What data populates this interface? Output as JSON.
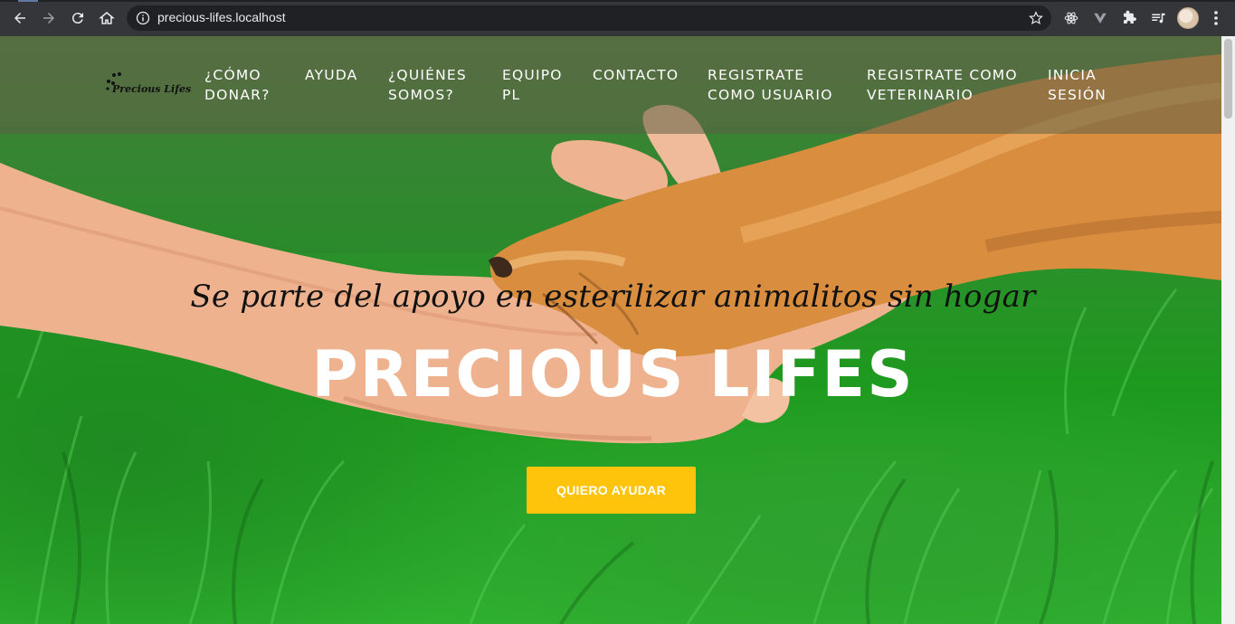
{
  "browser": {
    "url": "precious-lifes.localhost",
    "icons": [
      "back-icon",
      "forward-icon",
      "reload-icon",
      "home-icon",
      "info-icon",
      "star-icon",
      "react-devtools-icon",
      "vue-devtools-icon",
      "extensions-icon",
      "media-controls-icon",
      "profile-avatar",
      "more-menu-icon"
    ]
  },
  "site": {
    "logo_text": "Precious Lifes",
    "menu": [
      {
        "label_line1": "¿CÓMO",
        "label_line2": "DONAR?"
      },
      {
        "label_line1": "AYUDA",
        "label_line2": ""
      },
      {
        "label_line1": "¿QUIÉNES",
        "label_line2": "SOMOS?"
      },
      {
        "label_line1": "EQUIPO",
        "label_line2": "PL"
      },
      {
        "label_line1": "CONTACTO",
        "label_line2": ""
      },
      {
        "label_line1": "REGISTRATE",
        "label_line2": "COMO USUARIO"
      },
      {
        "label_line1": "REGISTRATE COMO",
        "label_line2": "VETERINARIO"
      },
      {
        "label_line1": "INICIA",
        "label_line2": "SESIÓN"
      }
    ],
    "hero": {
      "tagline": "Se parte del apoyo en esterilizar animalitos sin hogar",
      "title": "PRECIOUS LIFES",
      "cta_label": "QUIERO AYUDAR"
    },
    "colors": {
      "cta": "#fec40b",
      "menu_text": "#ffffff",
      "nav_overlay": "rgba(95,95,70,0.55)"
    }
  }
}
